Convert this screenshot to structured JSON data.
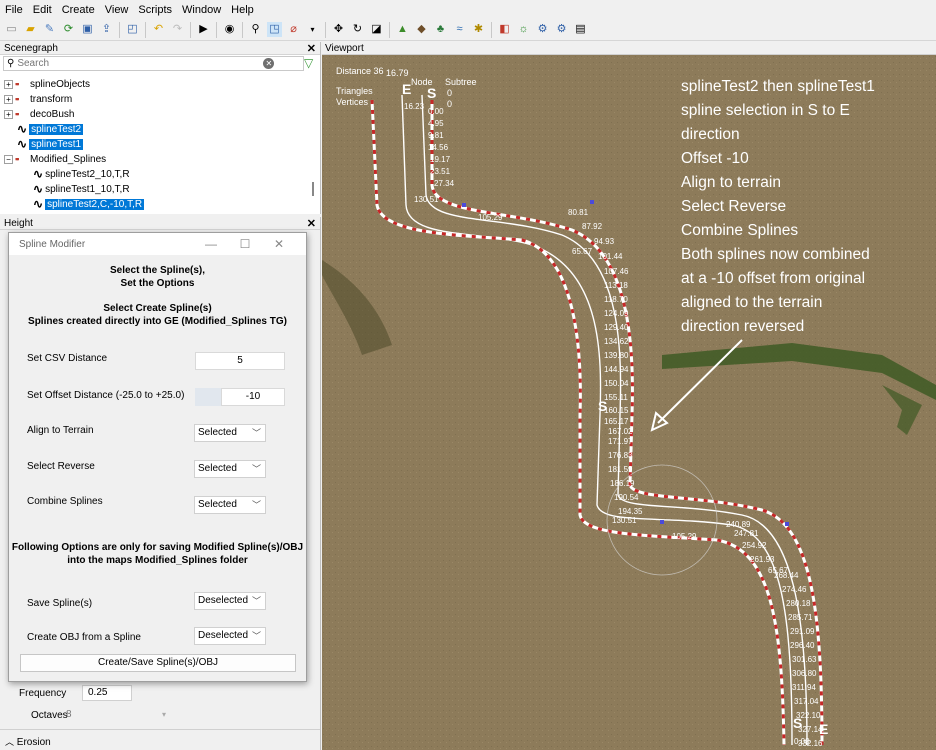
{
  "menubar": {
    "items": [
      "File",
      "Edit",
      "Create",
      "View",
      "Scripts",
      "Window",
      "Help"
    ]
  },
  "scenegraph": {
    "title": "Scenegraph",
    "search_placeholder": "Search",
    "items": [
      {
        "label": "splineObjects"
      },
      {
        "label": "transform"
      },
      {
        "label": "decoBush"
      },
      {
        "label": "splineTest2"
      },
      {
        "label": "splineTest1"
      },
      {
        "label": "Modified_Splines"
      },
      {
        "label": "splineTest2_10,T,R"
      },
      {
        "label": "splineTest1_10,T,R"
      },
      {
        "label": "splineTest2,C,-10,T,R"
      }
    ]
  },
  "height_panel": {
    "title": "Height",
    "frequency_label": "Frequency",
    "frequency_value": "0.25",
    "octaves_label": "Octaves",
    "octaves_value": "8",
    "erosion_label": "Erosion"
  },
  "dialog": {
    "title": "Spline Modifier",
    "heading1": "Select the Spline(s),",
    "heading2": "Set the Options",
    "heading3": "Select Create Spline(s)",
    "heading4": "Splines created directly into GE (Modified_Splines TG)",
    "csv_label": "Set CSV Distance",
    "csv_value": "5",
    "offset_label": "Set Offset Distance (-25.0 to +25.0)",
    "offset_value": "-10",
    "align_label": "Align to Terrain",
    "align_value": "Selected",
    "reverse_label": "Select Reverse",
    "reverse_value": "Selected",
    "combine_label": "Combine Splines",
    "combine_value": "Selected",
    "note1": "Following Options are only for saving Modified Spline(s)/OBJ",
    "note2": "into the maps Modified_Splines folder",
    "save_label": "Save Spline(s)",
    "save_value": "Deselected",
    "obj_label": "Create OBJ from a Spline",
    "obj_value": "Deselected",
    "button_label": "Create/Save Spline(s)/OBJ"
  },
  "viewport": {
    "title": "Viewport",
    "labels": {
      "distance": "Distance 36",
      "distance_val": "16.79",
      "triangles": "Triangles",
      "vertices": "Vertices",
      "node": "Node",
      "subtree": "Subtree",
      "node_val": "0",
      "subtree_val": "0",
      "start_top_e": "E",
      "start_top_s": "S",
      "mid_s": "S",
      "end_s": "S",
      "end_e": "E"
    },
    "annotation": [
      "splineTest2 then splineTest1",
      "spline selection in S to E",
      "direction",
      "Offset -10",
      "Align to terrain",
      "Select Reverse",
      "Combine Splines",
      "Both splines now combined",
      "at a -10 offset from original",
      "aligned to the terrain",
      "direction reversed"
    ],
    "upper_numbers": [
      "16.23",
      "0.00",
      "4.95",
      "9.81",
      "14.56",
      "19.17",
      "23.51",
      "27.34",
      "130.51",
      "105.29",
      "80.81",
      "87.92",
      "65.67",
      "94.93",
      "101.44",
      "107.46",
      "113.18",
      "118.70",
      "124.09",
      "129.40",
      "134.62",
      "139.80",
      "144.94",
      "150.04",
      "155.11",
      "160.15",
      "165.17"
    ],
    "lower_numbers": [
      "167.02",
      "171.97",
      "176.83",
      "181.59",
      "186.19",
      "190.54",
      "194.35",
      "130.51",
      "105.29",
      "240.89",
      "247.81",
      "254.92",
      "261.93",
      "65.67",
      "268.44",
      "274.46",
      "280.18",
      "285.71",
      "291.09",
      "296.40",
      "301.63",
      "306.80",
      "311.94",
      "317.04",
      "322.10",
      "327.14",
      "332.16",
      "0.00"
    ]
  }
}
